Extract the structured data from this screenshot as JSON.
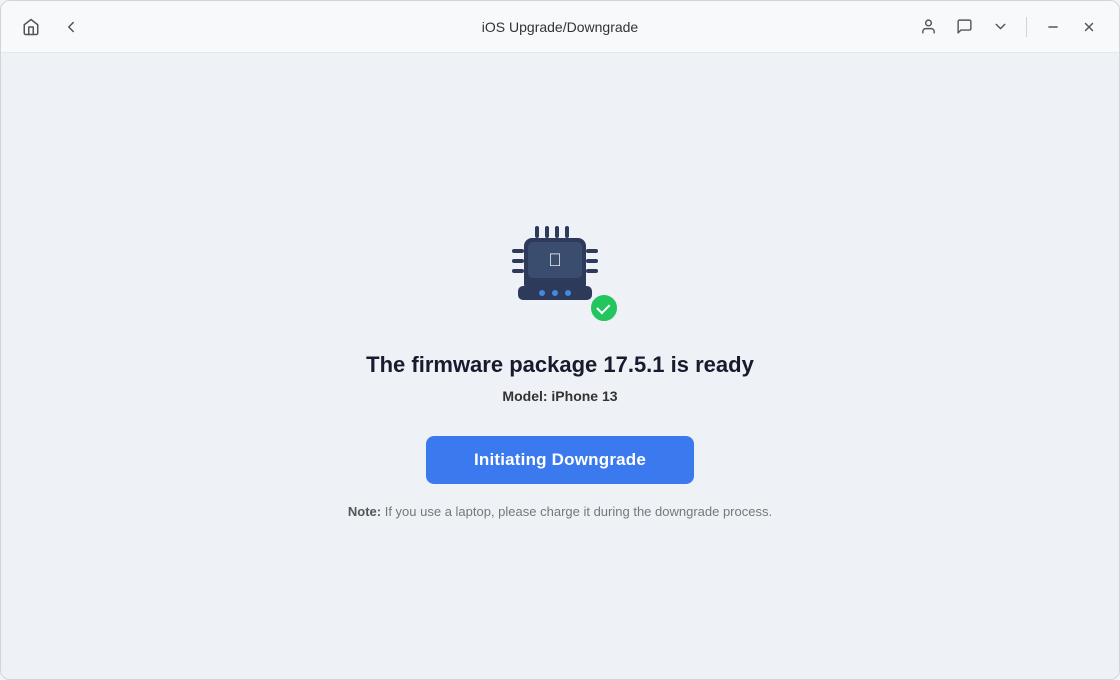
{
  "titleBar": {
    "title": "iOS Upgrade/Downgrade",
    "homeIcon": "⌂",
    "backIcon": "←",
    "userIcon": "👤",
    "messageIcon": "💬",
    "chevronIcon": "∨",
    "minimizeIcon": "—",
    "closeIcon": "✕"
  },
  "content": {
    "firmwareTitle": "The firmware package 17.5.1 is ready",
    "modelLabel": "Model:",
    "modelValue": "iPhone 13",
    "buttonLabel": "Initiating Downgrade",
    "noteLabel": "Note:",
    "noteText": "  If you use a laptop, please charge it during the downgrade process."
  }
}
